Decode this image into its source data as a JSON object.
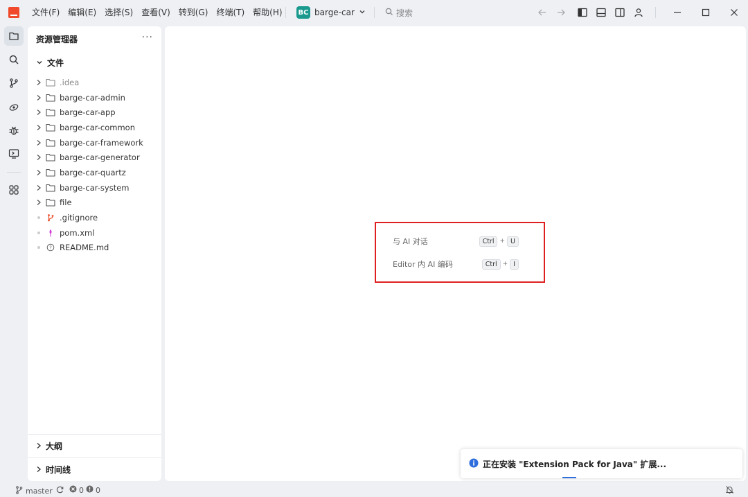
{
  "titlebar": {
    "menu": [
      {
        "label": "文件(F)"
      },
      {
        "label": "编辑(E)"
      },
      {
        "label": "选择(S)"
      },
      {
        "label": "查看(V)"
      },
      {
        "label": "转到(G)"
      },
      {
        "label": "终端(T)"
      },
      {
        "label": "帮助(H)"
      }
    ],
    "project_badge": "BC",
    "project_name": "barge-car",
    "search_label": "搜索",
    "colors": {
      "logo": "#f0492b",
      "badge": "#1a9a8f"
    }
  },
  "activity_bar": {
    "icons": [
      "explorer-icon",
      "search-icon",
      "source-control-icon",
      "ai-icon",
      "debug-icon",
      "remote-icon",
      "extensions-icon"
    ]
  },
  "sidebar": {
    "title": "资源管理器",
    "more": "···",
    "files_header": "文件",
    "items": [
      {
        "label": ".idea",
        "type": "folder",
        "muted": true
      },
      {
        "label": "barge-car-admin",
        "type": "folder"
      },
      {
        "label": "barge-car-app",
        "type": "folder"
      },
      {
        "label": "barge-car-common",
        "type": "folder"
      },
      {
        "label": "barge-car-framework",
        "type": "folder"
      },
      {
        "label": "barge-car-generator",
        "type": "folder"
      },
      {
        "label": "barge-car-quartz",
        "type": "folder"
      },
      {
        "label": "barge-car-system",
        "type": "folder"
      },
      {
        "label": "file",
        "type": "folder"
      },
      {
        "label": ".gitignore",
        "type": "git"
      },
      {
        "label": "pom.xml",
        "type": "maven"
      },
      {
        "label": "README.md",
        "type": "info"
      }
    ],
    "outline": "大纲",
    "timeline": "时间线"
  },
  "editor": {
    "shortcuts": [
      {
        "label": "与 AI 对话",
        "keys": [
          "Ctrl",
          "U"
        ]
      },
      {
        "label": "Editor 内 AI 编码",
        "keys": [
          "Ctrl",
          "I"
        ]
      }
    ],
    "highlight_color": "#e02020"
  },
  "notification": {
    "text": "正在安装 \"Extension Pack for Java\" 扩展..."
  },
  "statusbar": {
    "branch": "master",
    "errors": "0",
    "warnings": "0"
  }
}
